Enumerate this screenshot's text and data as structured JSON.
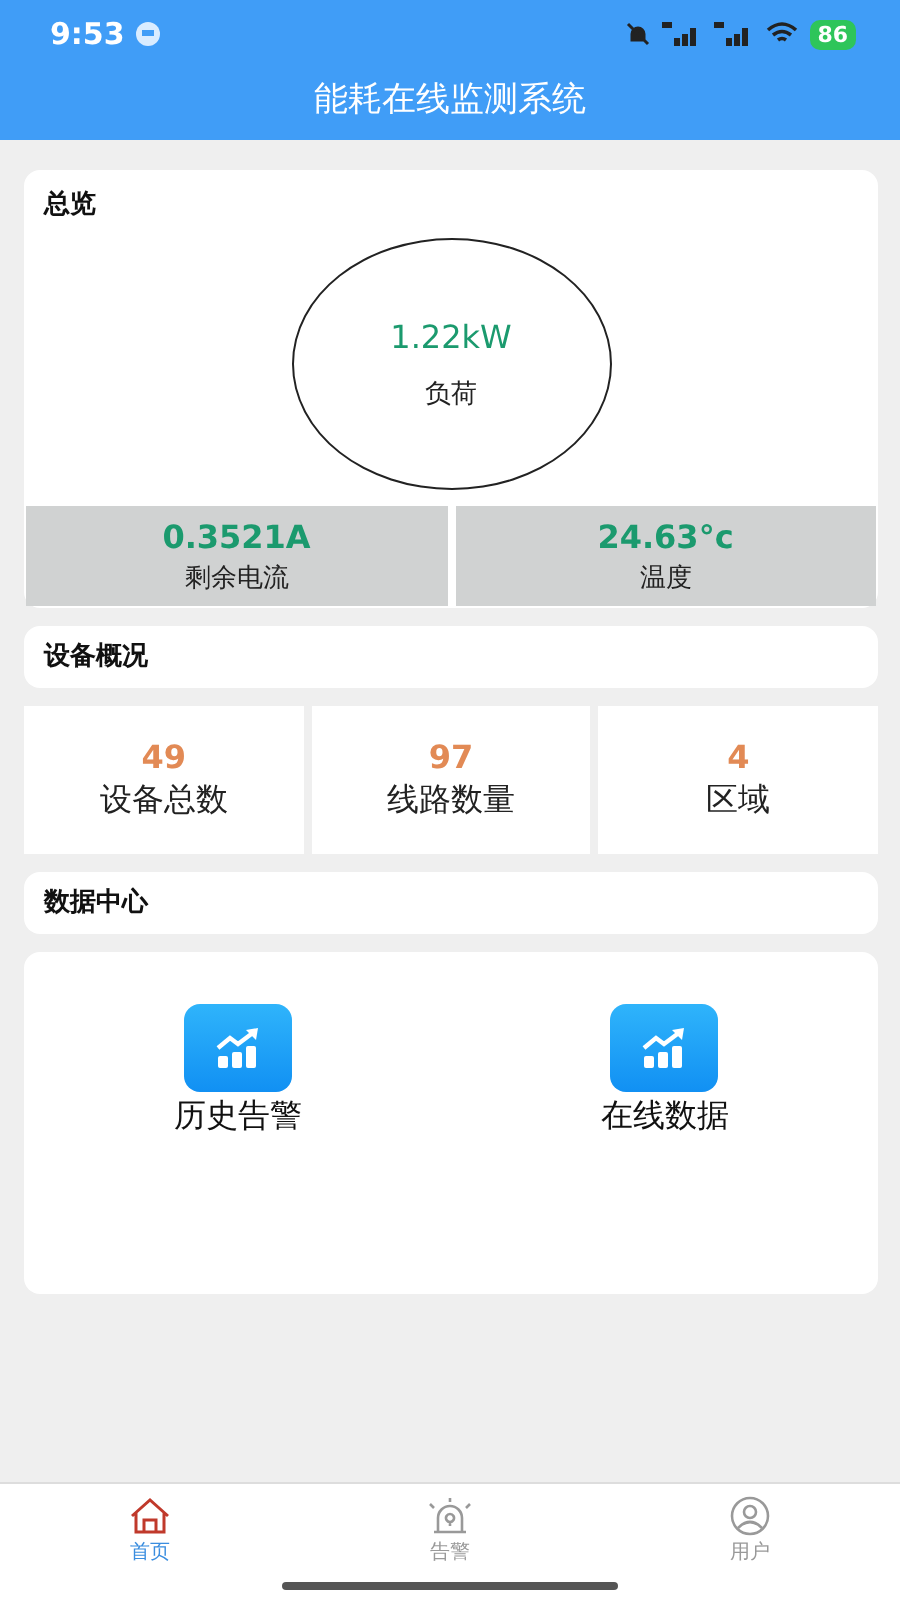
{
  "status_bar": {
    "time": "9:53",
    "battery": "86"
  },
  "header": {
    "title": "能耗在线监测系统"
  },
  "overview": {
    "title": "总览",
    "load_value": "1.22kW",
    "load_label": "负荷",
    "metrics": [
      {
        "value": "0.3521A",
        "label": "剩余电流"
      },
      {
        "value": "24.63°c",
        "label": "温度"
      }
    ]
  },
  "devices": {
    "title": "设备概况",
    "stats": [
      {
        "value": "49",
        "label": "设备总数"
      },
      {
        "value": "97",
        "label": "线路数量"
      },
      {
        "value": "4",
        "label": "区域"
      }
    ]
  },
  "data_center": {
    "title": "数据中心",
    "items": [
      {
        "label": "历史告警"
      },
      {
        "label": "在线数据"
      }
    ]
  },
  "tab_bar": [
    {
      "kind": "home",
      "label": "首页",
      "selected": true
    },
    {
      "kind": "alarm",
      "label": "告警",
      "selected": false
    },
    {
      "kind": "user",
      "label": "用户",
      "selected": false
    }
  ]
}
